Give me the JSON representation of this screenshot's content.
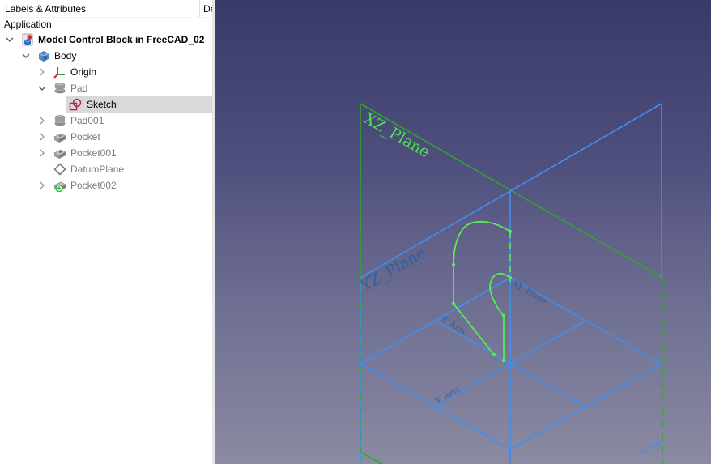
{
  "tree": {
    "header": {
      "column1": "Labels & Attributes",
      "column2": "De"
    },
    "items": [
      {
        "label": "Application",
        "level": 0,
        "style": "black",
        "expand": "none",
        "icon": "none"
      },
      {
        "label": "Model Control Block in FreeCAD_02",
        "level": 1,
        "style": "bold",
        "expand": "expanded",
        "icon": "document-icon"
      },
      {
        "label": "Body",
        "level": 2,
        "style": "black",
        "expand": "expanded",
        "icon": "body-icon"
      },
      {
        "label": "Origin",
        "level": 3,
        "style": "black",
        "expand": "collapsed",
        "icon": "origin-icon"
      },
      {
        "label": "Pad",
        "level": 3,
        "style": "gray",
        "expand": "expanded",
        "icon": "pad-icon"
      },
      {
        "label": "Sketch",
        "level": 4,
        "style": "black",
        "expand": "none",
        "icon": "sketch-icon",
        "selected": true
      },
      {
        "label": "Pad001",
        "level": 3,
        "style": "gray",
        "expand": "collapsed",
        "icon": "pad-icon"
      },
      {
        "label": "Pocket",
        "level": 3,
        "style": "gray",
        "expand": "collapsed",
        "icon": "pocket-icon"
      },
      {
        "label": "Pocket001",
        "level": 3,
        "style": "gray",
        "expand": "collapsed",
        "icon": "pocket-icon"
      },
      {
        "label": "DatumPlane",
        "level": 3,
        "style": "gray",
        "expand": "none",
        "icon": "datum-plane-icon"
      },
      {
        "label": "Pocket002",
        "level": 3,
        "style": "gray",
        "expand": "collapsed",
        "icon": "pocket-error-icon"
      }
    ]
  },
  "viewport": {
    "labels": {
      "xz_plane": "XZ_Plane",
      "yz_plane": "YZ_Plane",
      "xy_plane": "XY_Plane",
      "x_axis": "X_Axis",
      "y_axis": "Y_Axis"
    },
    "colors": {
      "xz_plane": "#2fa52f",
      "blue_planes": "#3f8ff0",
      "sketch": "#55ee55",
      "label_blue": "#2f5f9f",
      "label_green": "#4fe04f"
    }
  }
}
